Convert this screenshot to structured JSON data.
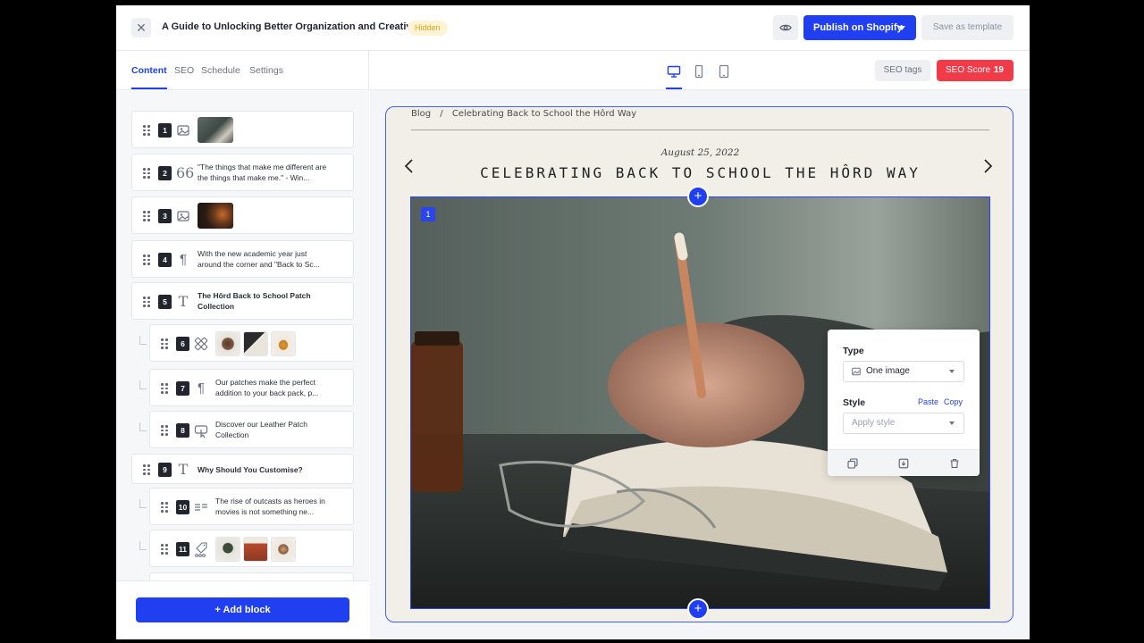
{
  "header": {
    "title": "A Guide to Unlocking Better Organization and Creativity",
    "status_badge": "Hidden",
    "publish_label": "Publish on Shopify",
    "save_template_label": "Save as template"
  },
  "left_panel": {
    "tabs": [
      {
        "label": "Content",
        "active": true
      },
      {
        "label": "SEO",
        "active": false
      },
      {
        "label": "Schedule",
        "active": false
      },
      {
        "label": "Settings",
        "active": false
      }
    ],
    "blocks": [
      {
        "number": "1",
        "icon": "image-icon",
        "text": ""
      },
      {
        "number": "2",
        "icon": "quote-icon",
        "text": "\"The things that make me different are the things that make me.\" - Win..."
      },
      {
        "number": "3",
        "icon": "image-icon",
        "text": ""
      },
      {
        "number": "4",
        "icon": "paragraph-icon",
        "text": "With the new academic year just around the corner and \"Back to Sc..."
      },
      {
        "number": "5",
        "icon": "heading-icon",
        "text": "The Hôrd Back to School Patch Collection"
      },
      {
        "number": "6",
        "icon": "gallery-icon",
        "text": ""
      },
      {
        "number": "7",
        "icon": "paragraph-icon",
        "text": "Our patches make the perfect addition to your back pack, p..."
      },
      {
        "number": "8",
        "icon": "button-icon",
        "text": "Discover our Leather Patch Collection"
      },
      {
        "number": "9",
        "icon": "heading-icon",
        "text": "Why Should You Customise?"
      },
      {
        "number": "10",
        "icon": "text-icon",
        "text": "The rise of outcasts as heroes in movies is not something ne..."
      },
      {
        "number": "11",
        "icon": "product-icon",
        "text": ""
      }
    ],
    "add_block_label": "Add block"
  },
  "canvas": {
    "seo_tags_label": "SEO tags",
    "seo_score_label": "SEO Score",
    "seo_score_value": "19",
    "breadcrumb": {
      "root": "Blog",
      "separator": "/",
      "current": "Celebrating Back to School the Hôrd Way"
    },
    "post_date": "August 25, 2022",
    "post_title": "CELEBRATING BACK TO SCHOOL THE HÔRD WAY",
    "image_block_number": "1"
  },
  "block_popup": {
    "type_label": "Type",
    "type_value": "One image",
    "style_label": "Style",
    "paste_label": "Paste",
    "copy_label": "Copy",
    "style_placeholder": "Apply style"
  },
  "colors": {
    "accent": "#1f3ff0",
    "seo_score_bg": "#f13b49",
    "hidden_badge_bg": "#fdf3d5",
    "hidden_badge_text": "#d9a520",
    "preview_bg": "#f2efe8"
  }
}
